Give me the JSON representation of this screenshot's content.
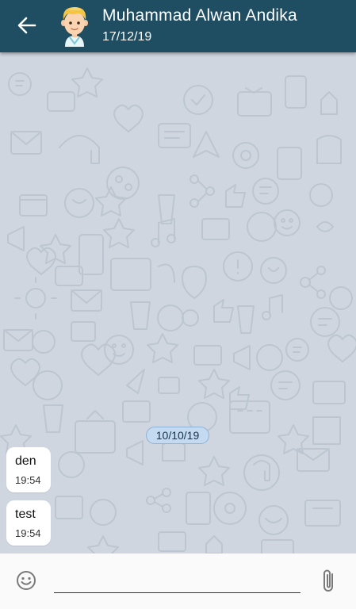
{
  "header": {
    "contact_name": "Muhammad Alwan Andika",
    "last_seen": "17/12/19",
    "back_icon": "arrow-left-icon",
    "avatar_icon": "cartoon-boy-avatar"
  },
  "chat": {
    "date_divider": "10/10/19",
    "messages": [
      {
        "text": "den",
        "time": "19:54"
      },
      {
        "text": "test",
        "time": "19:54"
      }
    ]
  },
  "composer": {
    "placeholder": "",
    "emoji_icon": "smiley-icon",
    "attach_icon": "paperclip-icon"
  },
  "colors": {
    "header": "#1f4e63",
    "chat_background": "#cfd6df",
    "date_chip": "#c4daf0",
    "bubble": "#ffffff"
  }
}
